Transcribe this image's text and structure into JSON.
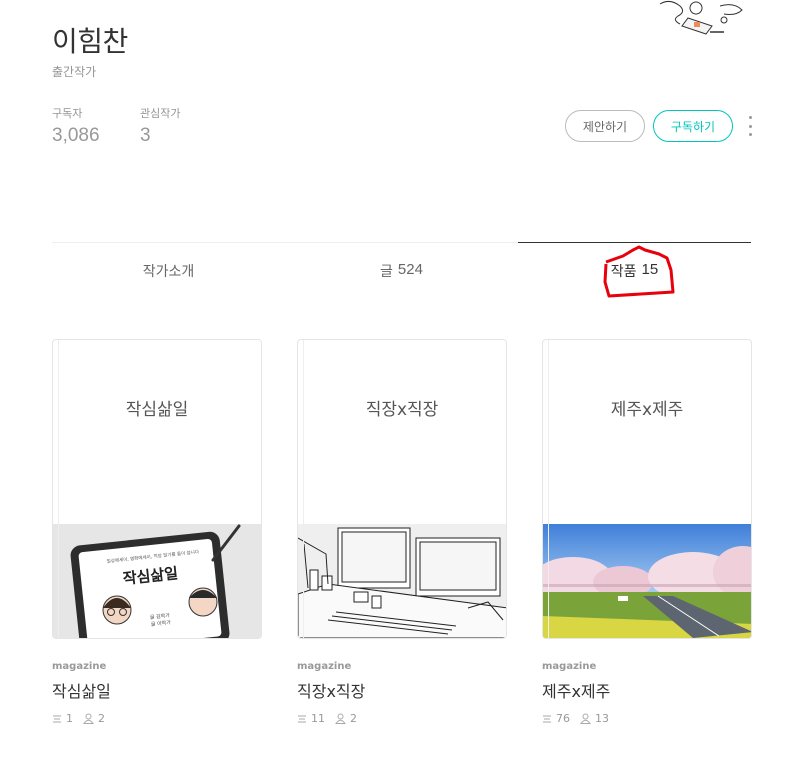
{
  "profile": {
    "name": "이힘찬",
    "role": "출간작가",
    "stats": {
      "subscribers_label": "구독자",
      "subscribers_value": "3,086",
      "interest_label": "관심작가",
      "interest_value": "3"
    },
    "buttons": {
      "propose": "제안하기",
      "subscribe": "구독하기"
    }
  },
  "tabs": [
    {
      "label": "작가소개",
      "count": ""
    },
    {
      "label": "글",
      "count": "524"
    },
    {
      "label": "작품",
      "count": "15"
    }
  ],
  "active_tab": "작품",
  "highlight_color": "#e8000b",
  "accent_color": "#00c6be",
  "works": [
    {
      "type": "magazine",
      "book_title": "작심삶일",
      "title": "작심삶일",
      "articles": "1",
      "writers": "2",
      "cover": {
        "title": "작심삶일",
        "subtitle": "일상에세이, 영화에세이, 직장 일기를 둘이 씁니다",
        "byline_1": "글 김작가",
        "byline_2": "글 이작가"
      }
    },
    {
      "type": "magazine",
      "book_title": "직장x직장",
      "title": "직장x직장",
      "articles": "11",
      "writers": "2"
    },
    {
      "type": "magazine",
      "book_title": "제주x제주",
      "title": "제주x제주",
      "articles": "76",
      "writers": "13"
    }
  ]
}
